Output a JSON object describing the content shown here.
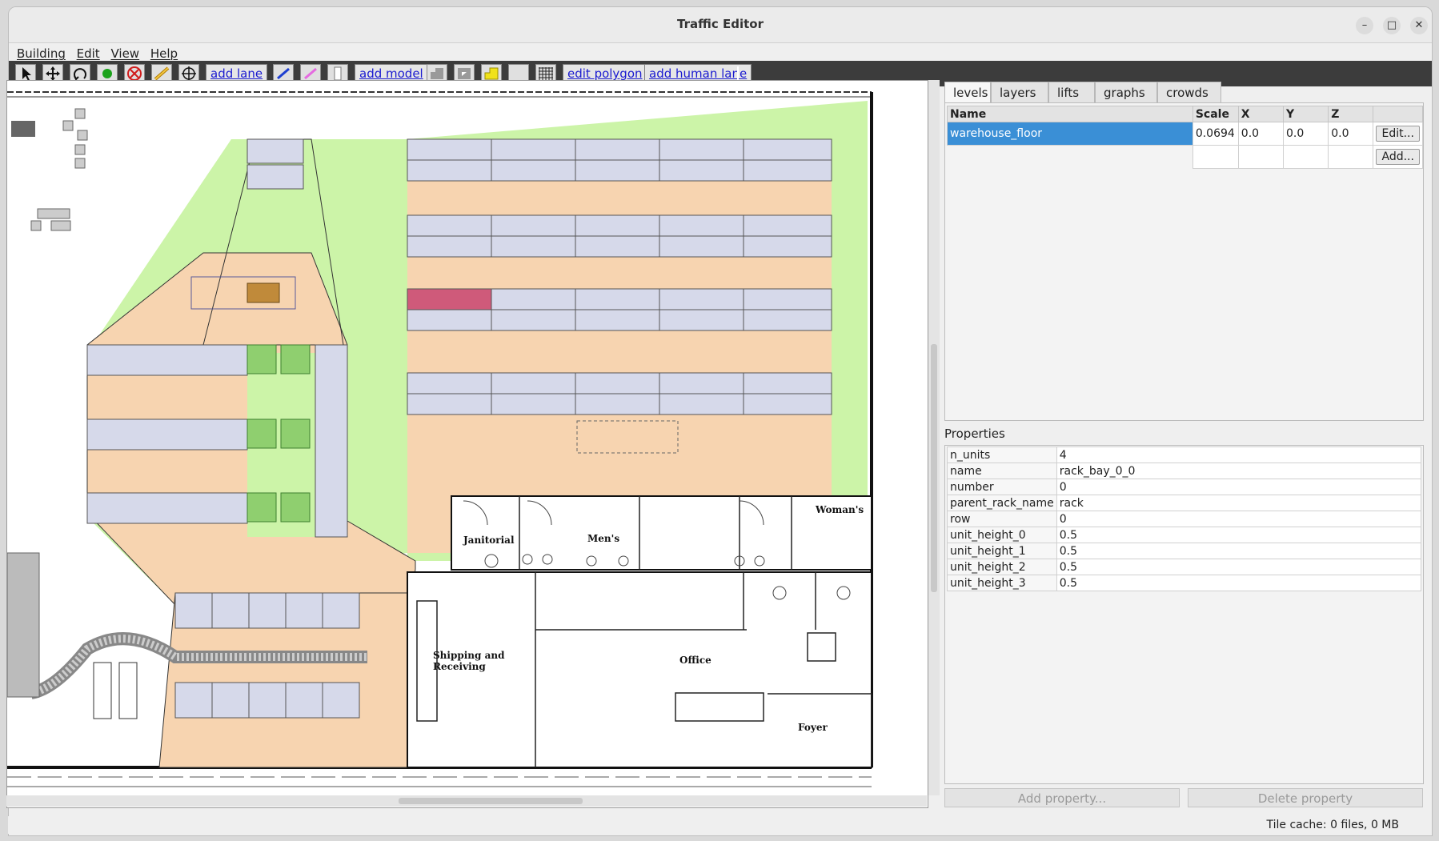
{
  "window": {
    "title": "Traffic Editor"
  },
  "menu": [
    "Building",
    "Edit",
    "View",
    "Help"
  ],
  "toolbar": {
    "add_lane": "add lane",
    "add_model": "add model",
    "edit_polygon": "edit polygon",
    "add_human_lane": "add human lane"
  },
  "tabs": [
    "levels",
    "layers",
    "lifts",
    "graphs",
    "crowds"
  ],
  "levels_table": {
    "headers": [
      "Name",
      "Scale",
      "X",
      "Y",
      "Z"
    ],
    "rows": [
      {
        "name": "warehouse_floor",
        "scale": "0.0694",
        "x": "0.0",
        "y": "0.0",
        "z": "0.0"
      }
    ],
    "edit_label": "Edit...",
    "add_label": "Add..."
  },
  "properties": {
    "title": "Properties",
    "rows": [
      {
        "key": "n_units",
        "value": "4"
      },
      {
        "key": "name",
        "value": "rack_bay_0_0"
      },
      {
        "key": "number",
        "value": "0"
      },
      {
        "key": "parent_rack_name",
        "value": "rack"
      },
      {
        "key": "row",
        "value": "0"
      },
      {
        "key": "unit_height_0",
        "value": "0.5"
      },
      {
        "key": "unit_height_1",
        "value": "0.5"
      },
      {
        "key": "unit_height_2",
        "value": "0.5"
      },
      {
        "key": "unit_height_3",
        "value": "0.5"
      }
    ],
    "add_button": "Add property...",
    "delete_button": "Delete property"
  },
  "map": {
    "room_labels": {
      "janitorial": "Janitorial",
      "mens": "Men's",
      "womans": "Woman's",
      "shipping_1": "Shipping and",
      "shipping_2": "Receiving",
      "office": "Office",
      "foyer": "Foyer"
    },
    "colors": {
      "floor_orange": "#f7d4b0",
      "floor_green": "#ccf4a8",
      "rack": "#d6d9ea",
      "selected_rack": "#cf5a7a"
    }
  },
  "status": {
    "text": "Tile cache: 0 files, 0 MB"
  }
}
